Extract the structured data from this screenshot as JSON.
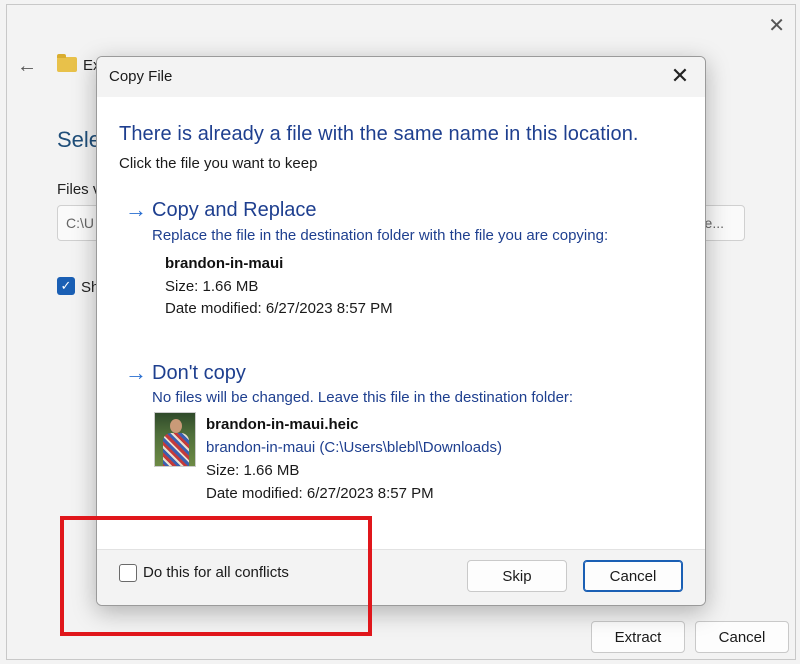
{
  "background": {
    "title_fragment": "Ex",
    "heading_fragment": "Sele",
    "files_label_fragment": "Files v",
    "path_fragment": "C:\\U",
    "browse_fragment": "e...",
    "checkbox_label_fragment": "Sh",
    "extract_label": "Extract",
    "cancel_label": "Cancel"
  },
  "dialog": {
    "title": "Copy File",
    "heading": "There is already a file with the same name in this location.",
    "subheading": "Click the file you want to keep",
    "replace_option": {
      "title": "Copy and Replace",
      "description": "Replace the file in the destination folder with the file you are copying:",
      "file_name": "brandon-in-maui",
      "size": "Size: 1.66 MB",
      "date_modified": "Date modified: 6/27/2023 8:57 PM"
    },
    "skip_option": {
      "title": "Don't copy",
      "description": "No files will be changed. Leave this file in the destination folder:",
      "file_name": "brandon-in-maui.heic",
      "path": "brandon-in-maui (C:\\Users\\blebl\\Downloads)",
      "size": "Size: 1.66 MB",
      "date_modified": "Date modified: 6/27/2023 8:57 PM"
    },
    "footer": {
      "checkbox_label": "Do this for all conflicts",
      "skip_label": "Skip",
      "cancel_label": "Cancel"
    }
  },
  "colors": {
    "heading_blue": "#1e3f8f",
    "arrow_blue": "#2a6fd1",
    "highlight_red": "#e0161b"
  },
  "icons": [
    "close-icon",
    "back-arrow-icon",
    "folder-icon",
    "check-icon",
    "arrow-right-icon"
  ]
}
